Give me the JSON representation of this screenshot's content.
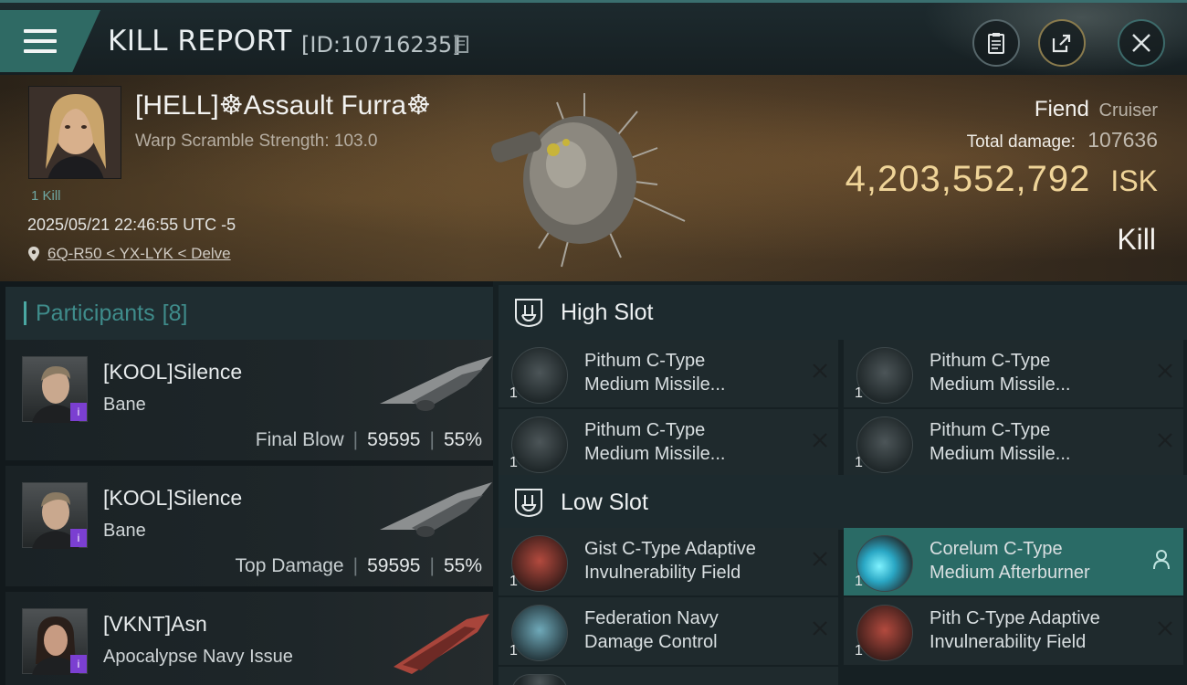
{
  "header": {
    "title": "KILL REPORT",
    "report_id": "[ID:10716235]"
  },
  "victim": {
    "name": "[HELL]☸Assault Furra☸",
    "warp_scramble": "Warp Scramble Strength: 103.0",
    "kill_count": "1 Kill",
    "timestamp": "2025/05/21 22:46:55 UTC -5",
    "location": "6Q-R50 < YX-LYK < Delve"
  },
  "loss": {
    "ship_name": "Fiend",
    "ship_class": "Cruiser",
    "total_damage_label": "Total damage:",
    "total_damage": "107636",
    "isk_value": "4,203,552,792",
    "isk_unit": "ISK",
    "result": "Kill"
  },
  "participants": {
    "label": "Participants",
    "count": "[8]",
    "rows": [
      {
        "name": "[KOOL]Silence",
        "ship": "Bane",
        "stat_label": "Final Blow",
        "damage": "59595",
        "percent": "55%"
      },
      {
        "name": "[KOOL]Silence",
        "ship": "Bane",
        "stat_label": "Top Damage",
        "damage": "59595",
        "percent": "55%"
      },
      {
        "name": "[VKNT]Asn",
        "ship": "Apocalypse Navy Issue",
        "stat_label": "",
        "damage": "",
        "percent": ""
      }
    ],
    "stat_separator": "|"
  },
  "fittings": {
    "high_slot_label": "High Slot",
    "low_slot_label": "Low Slot",
    "high": [
      {
        "name_line1": "Pithum C-Type",
        "name_line2": "Medium Missile...",
        "qty": "1"
      },
      {
        "name_line1": "Pithum C-Type",
        "name_line2": "Medium Missile...",
        "qty": "1"
      },
      {
        "name_line1": "Pithum C-Type",
        "name_line2": "Medium Missile...",
        "qty": "1"
      },
      {
        "name_line1": "Pithum C-Type",
        "name_line2": "Medium Missile...",
        "qty": "1"
      }
    ],
    "low": [
      {
        "name_line1": "Gist C-Type Adaptive",
        "name_line2": "Invulnerability Field",
        "qty": "1"
      },
      {
        "name_line1": "Corelum C-Type",
        "name_line2": "Medium Afterburner",
        "qty": "1"
      },
      {
        "name_line1": "Federation Navy",
        "name_line2": "Damage Control",
        "qty": "1"
      },
      {
        "name_line1": "Pith C-Type Adaptive",
        "name_line2": "Invulnerability Field",
        "qty": "1"
      }
    ]
  },
  "colors": {
    "accent_teal": "#2f6a64",
    "isk_gold": "#efd498",
    "active_module": "#2a6b66",
    "badge_purple": "#7b3fd1"
  },
  "icons": [
    "menu-icon",
    "copy-icon",
    "clipboard-icon",
    "share-icon",
    "close-icon",
    "location-pin-icon",
    "slot-icon",
    "remove-x-icon",
    "person-icon"
  ]
}
